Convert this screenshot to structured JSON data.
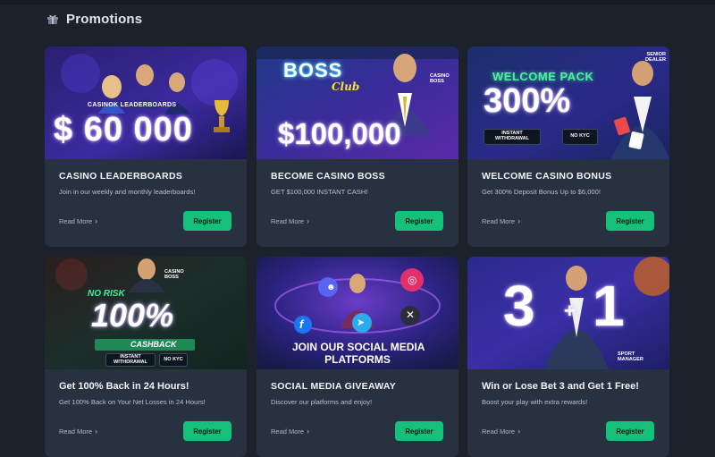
{
  "page": {
    "title": "Promotions",
    "icon": "gift-icon"
  },
  "colors": {
    "background": "#1b222c",
    "card": "#273140",
    "accent": "#14c07a"
  },
  "cards": [
    {
      "title": "CASINO LEADERBOARDS",
      "description": "Join in our weekly and monthly leaderboards!",
      "read_more": "Read More",
      "register": "Register",
      "banner": {
        "brand": "CASINOK LEADERBOARDS",
        "amount": "$ 60 000"
      }
    },
    {
      "title": "BECOME CASINO BOSS",
      "description": "GET $100,000 INSTANT CASH!",
      "read_more": "Read More",
      "register": "Register",
      "banner": {
        "logo_main": "BOSS",
        "logo_sub": "Club",
        "tag": "CASINO BOSS",
        "amount": "$100,000"
      }
    },
    {
      "title": "WELCOME CASINO BONUS",
      "description": "Get 300% Deposit Bonus Up to $6,000!",
      "read_more": "Read More",
      "register": "Register",
      "banner": {
        "heading": "WELCOME PACK",
        "amount": "300%",
        "tag": "SENIOR DEALER",
        "pill_left": "INSTANT WITHDRAWAL",
        "pill_right": "NO KYC"
      }
    },
    {
      "title": "Get 100% Back in 24 Hours!",
      "description": "Get 100% Back on Your Net Losses in 24 Hours!",
      "read_more": "Read More",
      "register": "Register",
      "banner": {
        "tag": "CASINO BOSS",
        "top": "NO RISK",
        "amount": "100%",
        "bottom": "CASHBACK",
        "pill_left": "INSTANT WITHDRAWAL",
        "pill_right": "NO KYC"
      }
    },
    {
      "title": "SOCIAL MEDIA GIVEAWAY",
      "description": "Discover our platforms and enjoy!",
      "read_more": "Read More",
      "register": "Register",
      "banner": {
        "line1": "JOIN OUR SOCIAL MEDIA",
        "line2": "PLATFORMS"
      }
    },
    {
      "title": "Win or Lose Bet 3 and Get 1 Free!",
      "description": "Boost your play with extra rewards!",
      "read_more": "Read More",
      "register": "Register",
      "banner": {
        "left": "3",
        "plus": "+",
        "right": "1",
        "tag": "SPORT MANAGER"
      }
    }
  ]
}
